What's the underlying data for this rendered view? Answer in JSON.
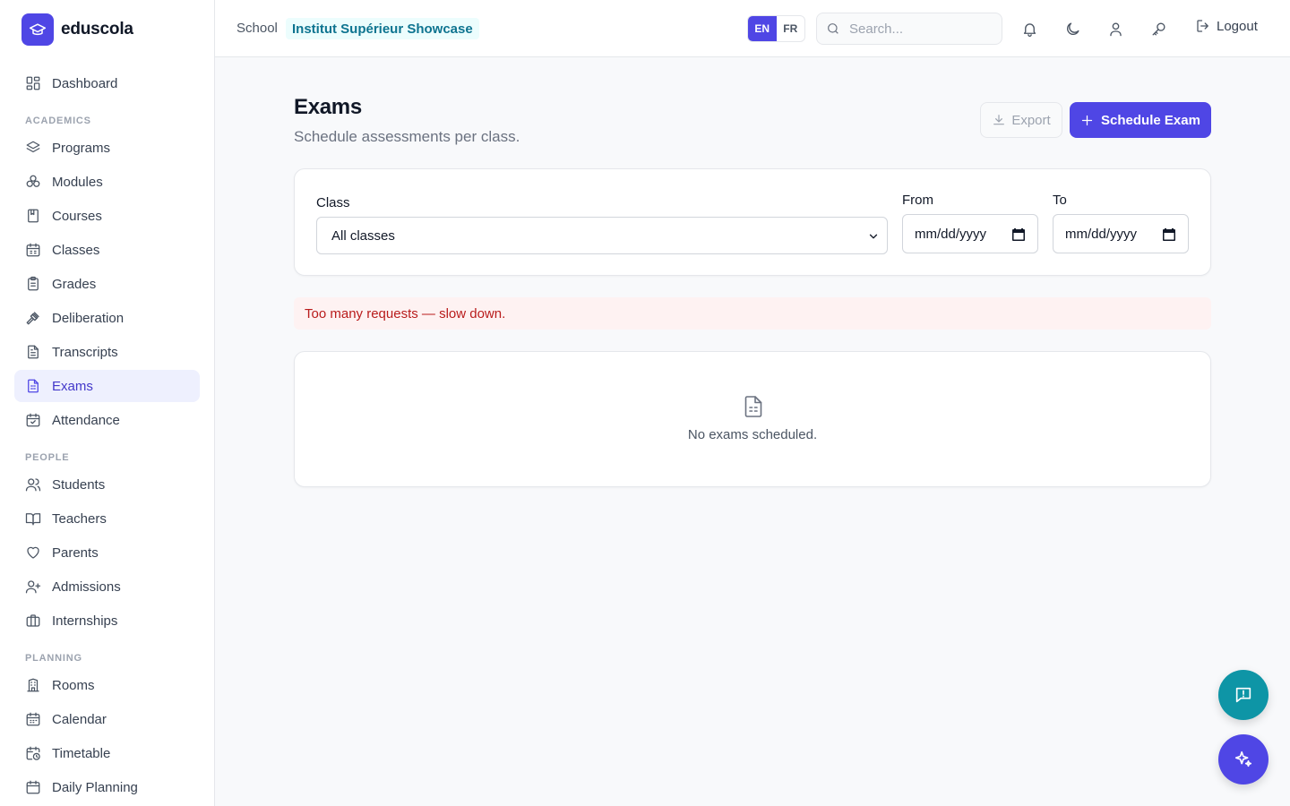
{
  "brand": {
    "name": "eduscola",
    "color": "#4f46e5"
  },
  "sidebar": {
    "dashboard": "Dashboard",
    "sections": [
      "ACADEMICS",
      "PEOPLE",
      "PLANNING"
    ],
    "academics": [
      {
        "label": "Programs",
        "icon": "layers-icon"
      },
      {
        "label": "Modules",
        "icon": "boxes-icon"
      },
      {
        "label": "Courses",
        "icon": "book-icon"
      },
      {
        "label": "Classes",
        "icon": "calendar-icon"
      },
      {
        "label": "Grades",
        "icon": "clipboard-icon"
      },
      {
        "label": "Deliberation",
        "icon": "gavel-icon"
      },
      {
        "label": "Transcripts",
        "icon": "file-text-icon"
      },
      {
        "label": "Exams",
        "icon": "file-spreadsheet-icon",
        "active": true
      },
      {
        "label": "Attendance",
        "icon": "calendar-check-icon"
      }
    ],
    "people": [
      {
        "label": "Students",
        "icon": "users-icon"
      },
      {
        "label": "Teachers",
        "icon": "book-open-icon"
      },
      {
        "label": "Parents",
        "icon": "heart-icon"
      },
      {
        "label": "Admissions",
        "icon": "user-plus-icon"
      },
      {
        "label": "Internships",
        "icon": "briefcase-icon"
      }
    ],
    "planning": [
      {
        "label": "Rooms",
        "icon": "building-icon"
      },
      {
        "label": "Calendar",
        "icon": "calendar-days-icon"
      },
      {
        "label": "Timetable",
        "icon": "calendar-clock-icon"
      },
      {
        "label": "Daily Planning",
        "icon": "calendar-icon"
      }
    ]
  },
  "header": {
    "school_label": "School",
    "school_name": "Institut Supérieur Showcase",
    "languages": [
      "EN",
      "FR"
    ],
    "active_language": "EN",
    "search_placeholder": "Search...",
    "logout": "Logout"
  },
  "main": {
    "title": "Exams",
    "subtitle": "Schedule assessments per class.",
    "export_label": "Export",
    "schedule_label": "Schedule Exam",
    "filters": {
      "class_label": "Class",
      "class_value": "All classes",
      "from_label": "From",
      "from_value": "mm/dd/yyyy",
      "to_label": "To",
      "to_value": "mm/dd/yyyy"
    },
    "alert": "Too many requests — slow down.",
    "empty_text": "No exams scheduled."
  },
  "colors": {
    "accent": "#4f46e5",
    "teal": "#0e95a6",
    "error": "#b91c1c"
  }
}
